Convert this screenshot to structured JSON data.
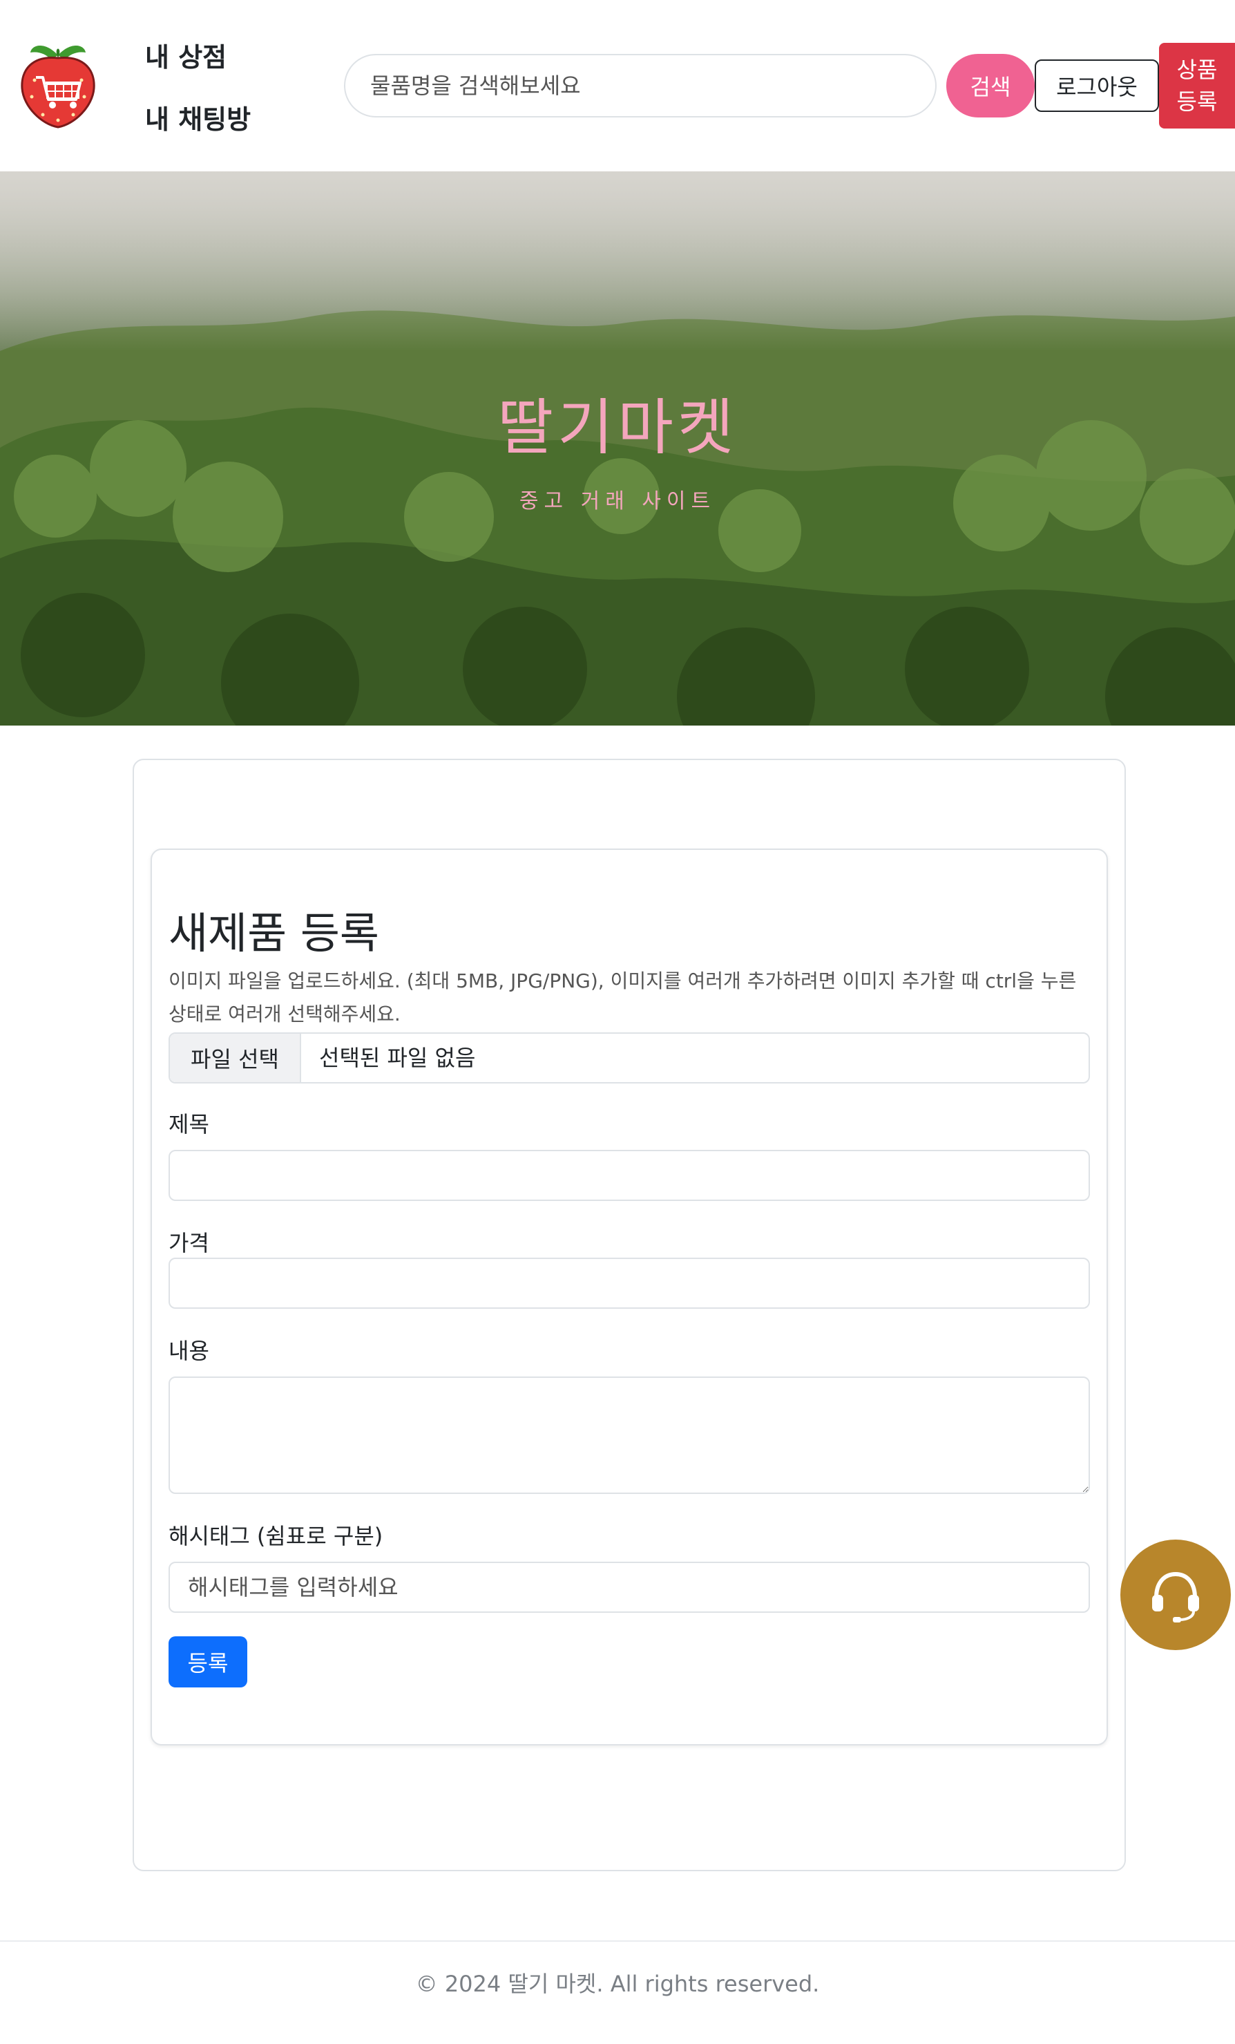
{
  "header": {
    "logo_icon": "strawberry-cart-icon",
    "nav": {
      "my_store": "내 상점",
      "my_chat": "내 채팅방"
    },
    "search": {
      "placeholder": "물품명을 검색해보세요",
      "button": "검색"
    },
    "logout": "로그아웃",
    "register_product": [
      "상품",
      "등록"
    ]
  },
  "hero": {
    "title": "딸기마켓",
    "subtitle": "중고 거래 사이트"
  },
  "form": {
    "title": "새제품 등록",
    "help": "이미지 파일을 업로드하세요. (최대 5MB, JPG/PNG), 이미지를 여러개 추가하려면 이미지 추가할 때 ctrl을 누른 상태로 여러개 선택해주세요.",
    "file": {
      "button": "파일 선택",
      "status": "선택된 파일 없음"
    },
    "fields": {
      "title_label": "제목",
      "title_value": "",
      "price_label": "가격",
      "price_value": "",
      "content_label": "내용",
      "content_value": "",
      "hashtag_label": "해시태그 (쉼표로 구분)",
      "hashtag_placeholder": "해시태그를 입력하세요"
    },
    "submit": "등록"
  },
  "support": {
    "icon": "headset-icon"
  },
  "footer": {
    "copyright": "© 2024 딸기 마켓. All rights reserved."
  },
  "colors": {
    "search_button": "#f06292",
    "register_button": "#dc3545",
    "submit_button": "#0d6efd",
    "support_button": "#b8862b",
    "hero_text": "#f4a6bd"
  }
}
